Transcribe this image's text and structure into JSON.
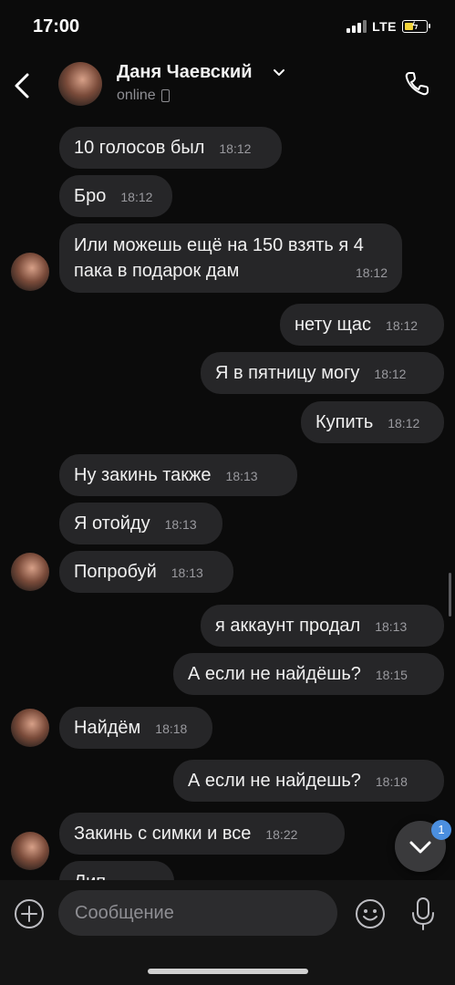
{
  "status": {
    "time": "17:00",
    "network": "LTE"
  },
  "header": {
    "name": "Даня Чаевский",
    "status": "online"
  },
  "messages": [
    {
      "text": "10 голосов был",
      "time": "18:12"
    },
    {
      "text": "Бро",
      "time": "18:12"
    },
    {
      "text": "Или можешь ещё на 150 взять я 4 пака в подарок дам",
      "time": "18:12"
    },
    {
      "text": "нету щас",
      "time": "18:12"
    },
    {
      "text": "Я в пятницу могу",
      "time": "18:12"
    },
    {
      "text": "Купить",
      "time": "18:12"
    },
    {
      "text": "Ну закинь также",
      "time": "18:13"
    },
    {
      "text": "Я отойду",
      "time": "18:13"
    },
    {
      "text": "Попробуй",
      "time": "18:13"
    },
    {
      "text": "я аккаунт продал",
      "time": "18:13"
    },
    {
      "text": "А если не найдёшь?",
      "time": "18:15"
    },
    {
      "text": "Найдём",
      "time": "18:18"
    },
    {
      "text": "А если не найдешь?",
      "time": "18:18"
    },
    {
      "text": "Закинь с симки и все",
      "time": "18:22"
    },
    {
      "text": "Лип",
      "time": ""
    }
  ],
  "fab": {
    "badge": "1"
  },
  "composer": {
    "placeholder": "Сообщение"
  },
  "colors": {
    "accent": "#4b8fe0",
    "bubble": "#262628",
    "background": "#0b0b0b"
  },
  "icons": [
    "back-arrow-icon",
    "chevron-down-icon",
    "phone-icon",
    "plus-icon",
    "emoji-icon",
    "microphone-icon"
  ]
}
